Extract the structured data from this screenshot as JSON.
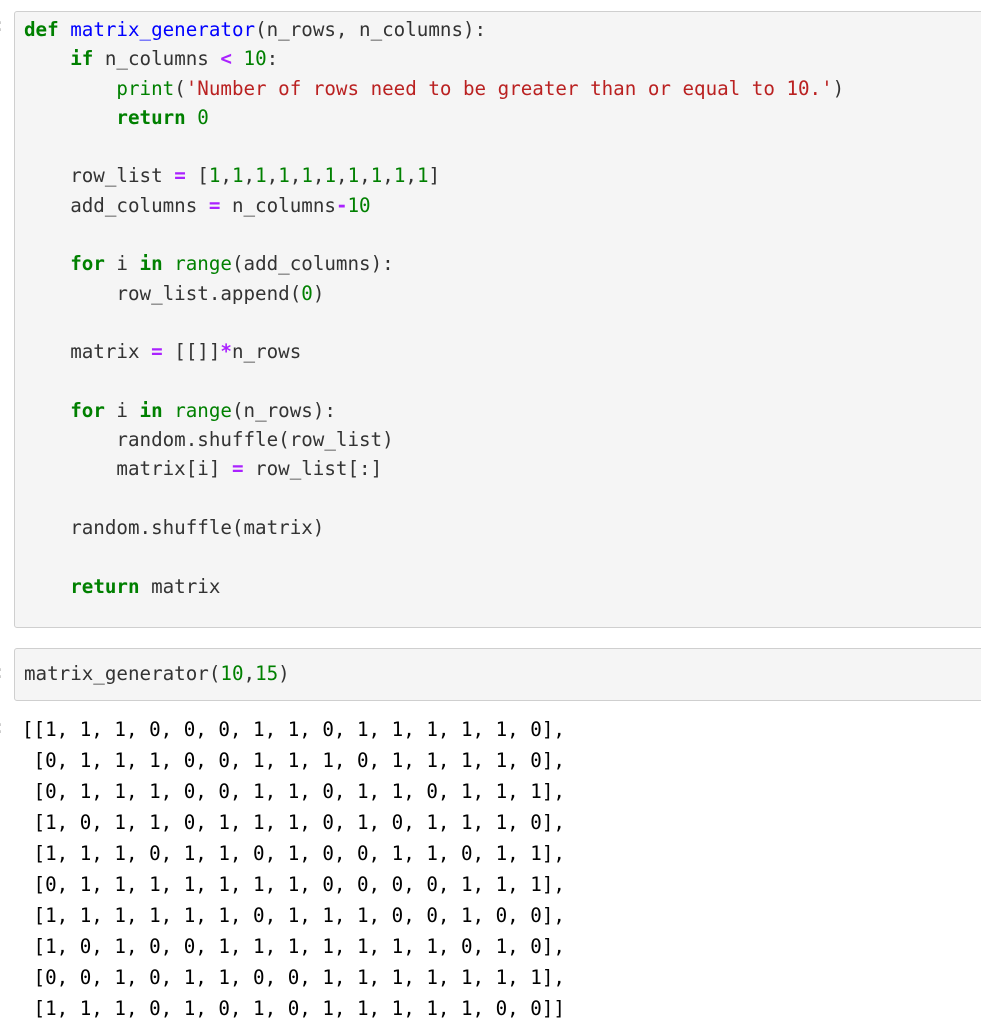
{
  "cells": [
    {
      "type": "code",
      "lines": [
        [
          [
            "kw",
            "def"
          ],
          [
            "txt",
            " "
          ],
          [
            "fn",
            "matrix_generator"
          ],
          [
            "txt",
            "(n_rows, n_columns):"
          ]
        ],
        [
          [
            "txt",
            "    "
          ],
          [
            "kw",
            "if"
          ],
          [
            "txt",
            " n_columns "
          ],
          [
            "op",
            "<"
          ],
          [
            "txt",
            " "
          ],
          [
            "num",
            "10"
          ],
          [
            "txt",
            ":"
          ]
        ],
        [
          [
            "txt",
            "        "
          ],
          [
            "bi",
            "print"
          ],
          [
            "txt",
            "("
          ],
          [
            "str",
            "'Number of rows need to be greater than or equal to 10.'"
          ],
          [
            "txt",
            ")"
          ]
        ],
        [
          [
            "txt",
            "        "
          ],
          [
            "kw",
            "return"
          ],
          [
            "txt",
            " "
          ],
          [
            "num",
            "0"
          ]
        ],
        [
          [
            "txt",
            ""
          ]
        ],
        [
          [
            "txt",
            "    row_list "
          ],
          [
            "op",
            "="
          ],
          [
            "txt",
            " ["
          ],
          [
            "num",
            "1"
          ],
          [
            "txt",
            ","
          ],
          [
            "num",
            "1"
          ],
          [
            "txt",
            ","
          ],
          [
            "num",
            "1"
          ],
          [
            "txt",
            ","
          ],
          [
            "num",
            "1"
          ],
          [
            "txt",
            ","
          ],
          [
            "num",
            "1"
          ],
          [
            "txt",
            ","
          ],
          [
            "num",
            "1"
          ],
          [
            "txt",
            ","
          ],
          [
            "num",
            "1"
          ],
          [
            "txt",
            ","
          ],
          [
            "num",
            "1"
          ],
          [
            "txt",
            ","
          ],
          [
            "num",
            "1"
          ],
          [
            "txt",
            ","
          ],
          [
            "num",
            "1"
          ],
          [
            "txt",
            "]"
          ]
        ],
        [
          [
            "txt",
            "    add_columns "
          ],
          [
            "op",
            "="
          ],
          [
            "txt",
            " n_columns"
          ],
          [
            "op",
            "-"
          ],
          [
            "num",
            "10"
          ]
        ],
        [
          [
            "txt",
            ""
          ]
        ],
        [
          [
            "txt",
            "    "
          ],
          [
            "kw",
            "for"
          ],
          [
            "txt",
            " i "
          ],
          [
            "kw",
            "in"
          ],
          [
            "txt",
            " "
          ],
          [
            "bi",
            "range"
          ],
          [
            "txt",
            "(add_columns):"
          ]
        ],
        [
          [
            "txt",
            "        row_list.append("
          ],
          [
            "num",
            "0"
          ],
          [
            "txt",
            ")"
          ]
        ],
        [
          [
            "txt",
            ""
          ]
        ],
        [
          [
            "txt",
            "    matrix "
          ],
          [
            "op",
            "="
          ],
          [
            "txt",
            " [[]]"
          ],
          [
            "op",
            "*"
          ],
          [
            "txt",
            "n_rows"
          ]
        ],
        [
          [
            "txt",
            ""
          ]
        ],
        [
          [
            "txt",
            "    "
          ],
          [
            "kw",
            "for"
          ],
          [
            "txt",
            " i "
          ],
          [
            "kw",
            "in"
          ],
          [
            "txt",
            " "
          ],
          [
            "bi",
            "range"
          ],
          [
            "txt",
            "(n_rows):"
          ]
        ],
        [
          [
            "txt",
            "        random.shuffle(row_list)"
          ]
        ],
        [
          [
            "txt",
            "        matrix[i] "
          ],
          [
            "op",
            "="
          ],
          [
            "txt",
            " row_list[:]"
          ]
        ],
        [
          [
            "txt",
            ""
          ]
        ],
        [
          [
            "txt",
            "    random.shuffle(matrix)"
          ]
        ],
        [
          [
            "txt",
            ""
          ]
        ],
        [
          [
            "txt",
            "    "
          ],
          [
            "kw",
            "return"
          ],
          [
            "txt",
            " matrix"
          ]
        ]
      ]
    },
    {
      "type": "code",
      "lines": [
        [
          [
            "txt",
            "matrix_generator("
          ],
          [
            "num",
            "10"
          ],
          [
            "txt",
            ","
          ],
          [
            "num",
            "15"
          ],
          [
            "txt",
            ")"
          ]
        ]
      ]
    }
  ],
  "output": {
    "matrix": [
      [
        1,
        1,
        1,
        0,
        0,
        0,
        1,
        1,
        0,
        1,
        1,
        1,
        1,
        1,
        0
      ],
      [
        0,
        1,
        1,
        1,
        0,
        0,
        1,
        1,
        1,
        0,
        1,
        1,
        1,
        1,
        0
      ],
      [
        0,
        1,
        1,
        1,
        0,
        0,
        1,
        1,
        0,
        1,
        1,
        0,
        1,
        1,
        1
      ],
      [
        1,
        0,
        1,
        1,
        0,
        1,
        1,
        1,
        0,
        1,
        0,
        1,
        1,
        1,
        0
      ],
      [
        1,
        1,
        1,
        0,
        1,
        1,
        0,
        1,
        0,
        0,
        1,
        1,
        0,
        1,
        1
      ],
      [
        0,
        1,
        1,
        1,
        1,
        1,
        1,
        1,
        0,
        0,
        0,
        0,
        1,
        1,
        1
      ],
      [
        1,
        1,
        1,
        1,
        1,
        1,
        0,
        1,
        1,
        1,
        0,
        0,
        1,
        0,
        0
      ],
      [
        1,
        0,
        1,
        0,
        0,
        1,
        1,
        1,
        1,
        1,
        1,
        1,
        0,
        1,
        0
      ],
      [
        0,
        0,
        1,
        0,
        1,
        1,
        0,
        0,
        1,
        1,
        1,
        1,
        1,
        1,
        1
      ],
      [
        1,
        1,
        1,
        0,
        1,
        0,
        1,
        0,
        1,
        1,
        1,
        1,
        1,
        0,
        0
      ]
    ]
  },
  "prompt_glyph": ":",
  "colors": {
    "keyword": "#008000",
    "function_name": "#0000ff",
    "string": "#ba2121",
    "operator": "#aa22ff",
    "cell_background": "#f5f5f5",
    "cell_border": "#cfcfcf"
  }
}
